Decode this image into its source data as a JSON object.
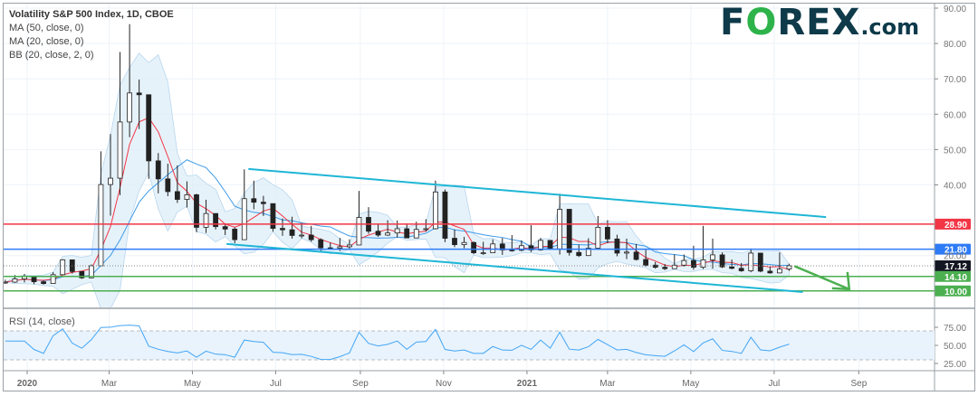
{
  "legend": {
    "title": "Volatility S&P 500 Index, 1D, CBOE",
    "indicators": [
      "MA (50, close, 0)",
      "MA (20, close, 0)",
      "BB (20, close, 2, 0)"
    ]
  },
  "logo": {
    "brand_f": "F",
    "brand_o": "O",
    "brand_rest": "REX",
    "domain": ".com"
  },
  "rsi_label": "RSI (14, close)",
  "colors": {
    "ma50": "#3d9be9",
    "ma20": "#f23645",
    "bb_fill": "#dcecf8",
    "channel": "#1fb6d6",
    "resistance": "#f23645",
    "support_blue": "#2e7bf6",
    "support_green": "#4caf50",
    "rsi": "#42a5f5",
    "up_candle": "#ffffff",
    "down_candle": "#222222"
  },
  "chart_data": {
    "type": "candlestick",
    "title": "Volatility S&P 500 Index, 1D, CBOE",
    "y_ticks": [
      "90.00",
      "80.00",
      "70.00",
      "60.00",
      "50.00",
      "40.00",
      "30.00",
      "20.00"
    ],
    "ylim": [
      10,
      90
    ],
    "x_ticks": [
      {
        "label": "2020",
        "date": "2020-01-01"
      },
      {
        "label": "Mar",
        "date": "2020-03-01"
      },
      {
        "label": "May",
        "date": "2020-05-01"
      },
      {
        "label": "Jul",
        "date": "2020-07-01"
      },
      {
        "label": "Sep",
        "date": "2020-09-01"
      },
      {
        "label": "Nov",
        "date": "2020-11-01"
      },
      {
        "label": "2021",
        "date": "2021-01-01"
      },
      {
        "label": "Mar",
        "date": "2021-03-01"
      },
      {
        "label": "May",
        "date": "2021-05-01"
      },
      {
        "label": "Jul",
        "date": "2021-07-01"
      },
      {
        "label": "Sep",
        "date": "2021-09-01"
      }
    ],
    "grid": true,
    "series_close": {
      "dates": [
        "2019-12-16",
        "2019-12-23",
        "2019-12-30",
        "2020-01-06",
        "2020-01-13",
        "2020-01-20",
        "2020-01-27",
        "2020-02-03",
        "2020-02-10",
        "2020-02-17",
        "2020-02-24",
        "2020-03-02",
        "2020-03-09",
        "2020-03-16",
        "2020-03-23",
        "2020-03-30",
        "2020-04-06",
        "2020-04-13",
        "2020-04-20",
        "2020-04-27",
        "2020-05-04",
        "2020-05-11",
        "2020-05-18",
        "2020-05-25",
        "2020-06-01",
        "2020-06-08",
        "2020-06-15",
        "2020-06-22",
        "2020-06-29",
        "2020-07-06",
        "2020-07-13",
        "2020-07-20",
        "2020-07-27",
        "2020-08-03",
        "2020-08-10",
        "2020-08-17",
        "2020-08-24",
        "2020-08-31",
        "2020-09-07",
        "2020-09-14",
        "2020-09-21",
        "2020-09-28",
        "2020-10-05",
        "2020-10-12",
        "2020-10-19",
        "2020-10-26",
        "2020-11-02",
        "2020-11-09",
        "2020-11-16",
        "2020-11-23",
        "2020-11-30",
        "2020-12-07",
        "2020-12-14",
        "2020-12-21",
        "2020-12-28",
        "2021-01-04",
        "2021-01-11",
        "2021-01-18",
        "2021-01-25",
        "2021-02-01",
        "2021-02-08",
        "2021-02-15",
        "2021-02-22",
        "2021-03-01",
        "2021-03-08",
        "2021-03-15",
        "2021-03-22",
        "2021-03-29",
        "2021-04-05",
        "2021-04-12",
        "2021-04-19",
        "2021-04-26",
        "2021-05-03",
        "2021-05-10",
        "2021-05-17",
        "2021-05-24",
        "2021-05-31",
        "2021-06-07",
        "2021-06-14",
        "2021-06-21",
        "2021-06-28",
        "2021-07-05",
        "2021-07-12"
      ],
      "close": [
        12.5,
        13.4,
        14.0,
        12.6,
        12.1,
        14.6,
        18.8,
        15.5,
        13.7,
        17.1,
        40.1,
        41.9,
        57.8,
        66.0,
        65.5,
        46.8,
        41.7,
        38.1,
        35.9,
        37.2,
        28.0,
        31.9,
        28.2,
        27.5,
        24.5,
        36.1,
        35.1,
        34.7,
        27.7,
        27.3,
        25.7,
        25.8,
        24.5,
        22.2,
        22.1,
        22.5,
        23.0,
        30.8,
        26.9,
        25.8,
        26.4,
        27.6,
        25.0,
        27.4,
        27.6,
        38.0,
        24.9,
        23.1,
        23.7,
        20.8,
        20.8,
        23.3,
        21.6,
        21.5,
        22.8,
        21.6,
        24.3,
        21.9,
        33.1,
        20.9,
        20.0,
        22.1,
        28.0,
        24.7,
        20.7,
        21.0,
        18.9,
        17.3,
        16.7,
        16.3,
        17.3,
        18.6,
        16.7,
        18.8,
        20.2,
        16.8,
        16.4,
        15.7,
        20.7,
        15.6,
        15.1,
        16.2,
        17.12
      ],
      "high": [
        13.2,
        14.5,
        14.8,
        14.0,
        13.0,
        15.3,
        19.0,
        18.9,
        14.5,
        17.5,
        49.5,
        54.4,
        77.6,
        85.5,
        69.8,
        57.4,
        49.0,
        46.0,
        45.5,
        41.0,
        37.5,
        35.8,
        31.5,
        29.0,
        28.0,
        44.4,
        41.2,
        36.9,
        33.5,
        30.5,
        31.0,
        29.3,
        28.4,
        24.9,
        23.7,
        25.0,
        24.6,
        38.3,
        33.7,
        29.1,
        30.0,
        29.9,
        29.1,
        29.6,
        30.3,
        41.2,
        38.7,
        27.4,
        25.3,
        24.0,
        23.9,
        24.6,
        25.0,
        25.8,
        24.3,
        28.6,
        25.0,
        23.7,
        37.5,
        27.2,
        23.1,
        24.9,
        31.2,
        30.0,
        25.9,
        24.8,
        23.3,
        21.6,
        18.2,
        17.6,
        20.3,
        20.3,
        22.8,
        28.4,
        24.8,
        20.9,
        18.9,
        17.9,
        22.0,
        18.1,
        16.8,
        20.9,
        17.7
      ],
      "low": [
        12.0,
        12.3,
        12.4,
        11.9,
        11.8,
        12.3,
        16.2,
        14.9,
        13.4,
        13.6,
        18.0,
        31.3,
        37.1,
        53.5,
        55.8,
        41.7,
        37.6,
        36.8,
        34.9,
        33.6,
        26.6,
        26.4,
        27.4,
        25.8,
        23.5,
        24.4,
        33.1,
        31.2,
        26.8,
        25.6,
        24.8,
        24.9,
        23.9,
        21.3,
        21.9,
        21.3,
        21.9,
        26.3,
        26.2,
        25.3,
        25.6,
        25.1,
        24.9,
        25.4,
        26.8,
        27.4,
        23.8,
        22.4,
        22.1,
        20.4,
        20.2,
        20.9,
        20.2,
        21.1,
        21.2,
        21.0,
        21.4,
        21.6,
        20.3,
        20.0,
        19.6,
        19.9,
        21.8,
        23.5,
        19.8,
        19.0,
        18.6,
        16.9,
        16.3,
        15.9,
        16.3,
        16.9,
        16.0,
        16.2,
        16.3,
        16.5,
        16.1,
        15.4,
        15.3,
        15.3,
        14.9,
        15.0,
        15.7
      ]
    },
    "peak": {
      "date": "2020-03-18",
      "high": 85.47
    },
    "horizontal_levels": [
      {
        "label": "28.90",
        "value": 28.9,
        "color": "#f23645"
      },
      {
        "label": "21.80",
        "value": 21.8,
        "color": "#2e7bf6"
      },
      {
        "label": "17.12",
        "value": 17.12,
        "color": "#131722",
        "style": "dotted",
        "last_price": true
      },
      {
        "label": "14.10",
        "value": 14.1,
        "color": "#4caf50"
      },
      {
        "label": "10.00",
        "value": 10.0,
        "color": "#4caf50"
      }
    ],
    "channel": {
      "upper": [
        {
          "date": "2020-06-11",
          "value": 44.5
        },
        {
          "date": "2021-08-08",
          "value": 30.9
        }
      ],
      "lower": [
        {
          "date": "2020-05-26",
          "value": 23.3
        },
        {
          "date": "2021-07-22",
          "value": 9.7
        }
      ]
    },
    "arrow": {
      "from": {
        "date": "2021-07-16",
        "value": 17.0
      },
      "to": {
        "date": "2021-08-25",
        "value": 10.5
      },
      "color": "#4caf50"
    },
    "rsi": {
      "label": "RSI (14, close)",
      "ticks": [
        "75.00",
        "50.00",
        "25.00"
      ],
      "ylim": [
        15,
        95
      ],
      "overbought": 70,
      "oversold": 30
    }
  }
}
